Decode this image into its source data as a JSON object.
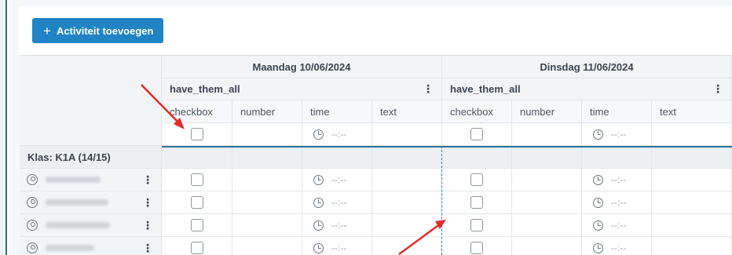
{
  "toolbar": {
    "add_activity_label": "Activiteit toevoegen"
  },
  "days": [
    {
      "title": "Maandag 10/06/2024",
      "group": "have_them_all",
      "columns": [
        "checkbox",
        "number",
        "time",
        "text"
      ]
    },
    {
      "title": "Dinsdag 11/06/2024",
      "group": "have_them_all",
      "columns": [
        "checkbox",
        "number",
        "time",
        "text"
      ]
    }
  ],
  "time_placeholder": "--:--",
  "class_group": {
    "label": "Klas: K1A (14/15)"
  },
  "students_count": 4,
  "colors": {
    "accent": "#1f83c4",
    "border_accent": "#2f6f99",
    "arrow": "#e52a2a"
  },
  "icons": {
    "add": "plus-icon",
    "clock": "clock-icon",
    "user": "user-circle-icon",
    "menu": "vertical-dots-icon"
  }
}
